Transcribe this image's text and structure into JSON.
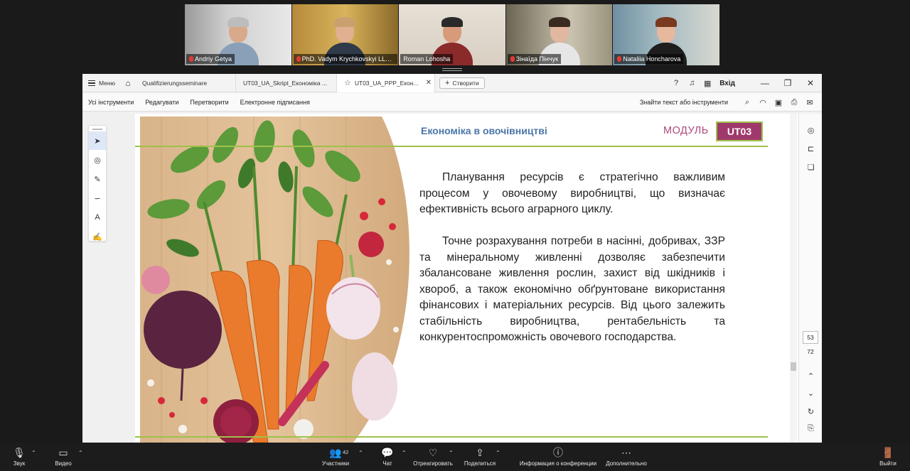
{
  "participants": [
    {
      "name": "Andriy Getya",
      "muted": true
    },
    {
      "name": "PhD. Vadym Krychkovskyi LLC Orga...",
      "muted": true
    },
    {
      "name": "Roman Lohosha",
      "muted": false,
      "speaking": true
    },
    {
      "name": "Зінаїда Пінчук",
      "muted": true
    },
    {
      "name": "Nataliia Honcharova",
      "muted": true
    }
  ],
  "pdf_app": {
    "menu_label": "Меню",
    "tabs": [
      {
        "label": "Qualifizierungsseminare",
        "active": false
      },
      {
        "label": "UT03_UA_Skript_Економіка ...",
        "active": false
      },
      {
        "label": "UT03_UA_PPP_Екон...",
        "active": true
      }
    ],
    "new_tab_label": "Створити",
    "sign_in_label": "Вхід",
    "toolbar_menus": [
      "Усі інструменти",
      "Редагувати",
      "Перетворити",
      "Електронне підписання"
    ],
    "find_text": "Знайти текст або інструменти",
    "current_page": "53",
    "total_pages": "72"
  },
  "slide": {
    "title": "Економіка в овочівництві",
    "module_label": "МОДУЛЬ",
    "module_code": "UT03",
    "paragraph1": "Планування ресурсів є стратегічно важливим процесом у овочевому виробництві, що визначає ефективність всього аграрного циклу.",
    "paragraph2": "Точне розрахування потреби в насінні, добривах, ЗЗР та мінеральному живленні дозволяє забезпечити збалансоване живлення рослин, захист від шкідників і хвороб, а також економічно обґрунтоване використання фінансових і матеріальних ресурсів. Від цього залежить стабільність виробництва, рентабельність та конкурентоспроможність овочевого господарства."
  },
  "meeting_controls": {
    "audio": "Звук",
    "video": "Видео",
    "participants": "Участники",
    "participants_count": "42",
    "chat": "Чат",
    "react": "Отреагировать",
    "share": "Поделиться",
    "info": "Информация о конференции",
    "more": "Дополнительно",
    "leave": "Выйти"
  },
  "colors": {
    "accent_green": "#9ec14a",
    "module_magenta": "#a0396b",
    "title_blue": "#4a76a8",
    "speaking_outline": "#2ecc71"
  }
}
